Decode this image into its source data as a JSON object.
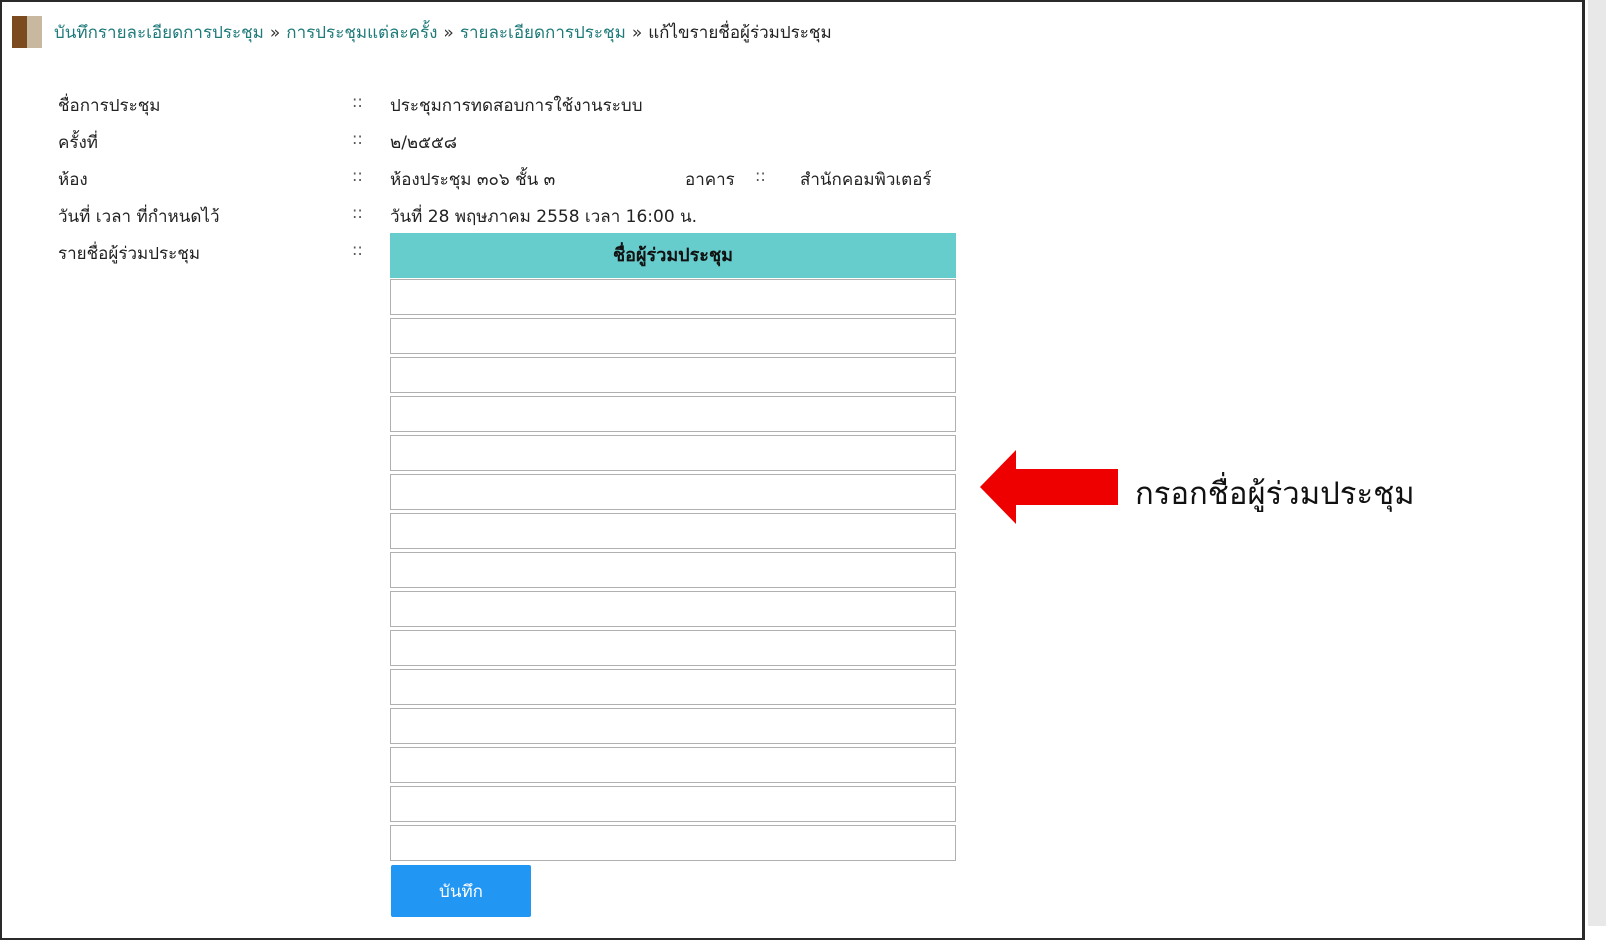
{
  "breadcrumb": {
    "items": [
      {
        "label": "บันทึกรายละเอียดการประชุม"
      },
      {
        "label": "การประชุมแต่ละครั้ง"
      },
      {
        "label": "รายละเอียดการประชุม"
      }
    ],
    "separator": "»",
    "current": "แก้ไขรายชื่อผู้ร่วมประชุม"
  },
  "meeting": {
    "name_label": "ชื่อการประชุม",
    "name_value": "ประชุมการทดสอบการใช้งานระบบ",
    "round_label": "ครั้งที่",
    "round_value": "๒/๒๕๕๘",
    "room_label": "ห้อง",
    "room_value": "ห้องประชุม ๓๐๖ ชั้น ๓",
    "building_label": "อาคาร",
    "building_value": "สำนักคอมพิวเตอร์",
    "datetime_label": "วันที่ เวลา ที่กำหนดไว้",
    "datetime_value": "วันที่ 28 พฤษภาคม 2558 เวลา 16:00 น.",
    "attendees_label": "รายชื่อผู้ร่วมประชุม",
    "separator": "::"
  },
  "attendee_table": {
    "header": "ชื่อผู้ร่วมประชุม",
    "rows": [
      "",
      "",
      "",
      "",
      "",
      "",
      "",
      "",
      "",
      "",
      "",
      "",
      "",
      "",
      ""
    ]
  },
  "save_button": {
    "label": "บันทึก",
    "color": "#2196f3"
  },
  "annotation": {
    "text": "กรอกชื่อผู้ร่วมประชุม",
    "arrow_icon": "left-arrow-icon",
    "arrow_color": "#ee0000"
  },
  "colors": {
    "header_bg": "#66cccc",
    "link": "#1f7a7a",
    "marker_dark": "#7b4a1f",
    "marker_light": "#c9b8a0"
  }
}
